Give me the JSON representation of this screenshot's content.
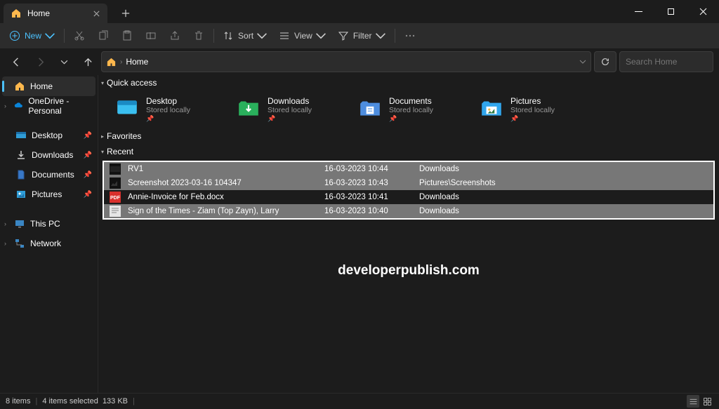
{
  "tab": {
    "title": "Home"
  },
  "toolbar": {
    "new": "New",
    "sort": "Sort",
    "view": "View",
    "filter": "Filter"
  },
  "breadcrumb": {
    "item": "Home"
  },
  "search": {
    "placeholder": "Search Home"
  },
  "sidebar": {
    "home": "Home",
    "onedrive": "OneDrive - Personal",
    "desktop": "Desktop",
    "downloads": "Downloads",
    "documents": "Documents",
    "pictures": "Pictures",
    "thispc": "This PC",
    "network": "Network"
  },
  "sections": {
    "quick_access": "Quick access",
    "favorites": "Favorites",
    "recent": "Recent"
  },
  "quick_access": [
    {
      "name": "Desktop",
      "sub": "Stored locally",
      "color": "#3abff0"
    },
    {
      "name": "Downloads",
      "sub": "Stored locally",
      "color": "#2ab05c"
    },
    {
      "name": "Documents",
      "sub": "Stored locally",
      "color": "#4d8dde"
    },
    {
      "name": "Pictures",
      "sub": "Stored locally",
      "color": "#31a6ed"
    }
  ],
  "recent_files": [
    {
      "name": "RV1",
      "date": "16-03-2023 10:44",
      "loc": "Downloads",
      "type": "video",
      "sel": true
    },
    {
      "name": "Screenshot 2023-03-16 104347",
      "date": "16-03-2023 10:43",
      "loc": "Pictures\\Screenshots",
      "type": "image",
      "sel": true
    },
    {
      "name": "Annie-Invoice for Feb.docx",
      "date": "16-03-2023 10:41",
      "loc": "Downloads",
      "type": "pdf",
      "sel": false
    },
    {
      "name": "Sign of the Times - Ziam (Top Zayn), Larry",
      "date": "16-03-2023 10:40",
      "loc": "Downloads",
      "type": "doc",
      "sel": true
    }
  ],
  "watermark": "developerpublish.com",
  "status": {
    "count": "8 items",
    "sel": "4 items selected",
    "size": "133 KB"
  }
}
